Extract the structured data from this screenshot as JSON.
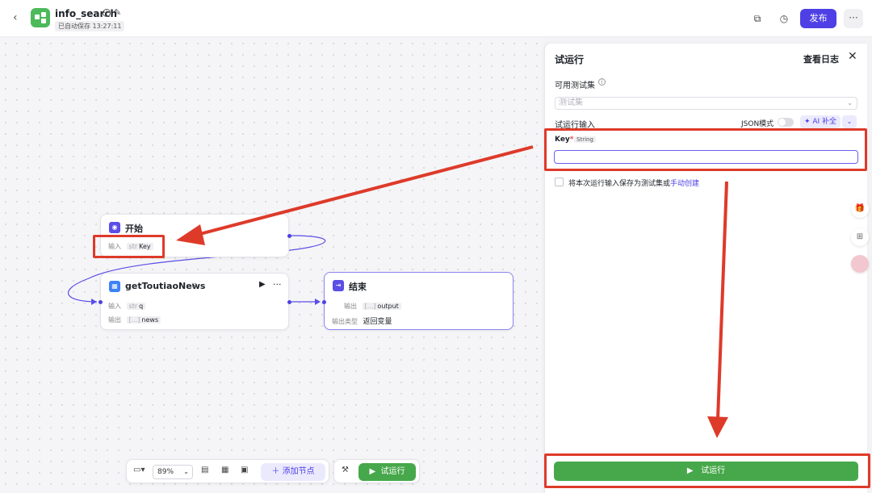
{
  "header": {
    "app_name": "info_search",
    "autosave": "已自动保存 13:27:11",
    "publish_label": "发布",
    "more_label": "···"
  },
  "nodes": {
    "start": {
      "title": "开始",
      "input_label": "输入",
      "input_type": "str",
      "input_name": "Key"
    },
    "plugin": {
      "title": "getToutiaoNews",
      "more_label": "···",
      "input_label": "输入",
      "input_type": "str",
      "input_name": "q",
      "output_label": "输出",
      "output_type": "[...]",
      "output_name": "news"
    },
    "end": {
      "title": "结束",
      "output_label": "输出",
      "output_type": "[...]",
      "output_name": "output",
      "output_kind_label": "输出类型",
      "output_kind_value": "返回变量"
    }
  },
  "toolbar": {
    "zoom": "89%",
    "add_node_label": "＋  添加节点",
    "run_label": "试运行"
  },
  "panel": {
    "title": "试运行",
    "view_log": "查看日志",
    "testset_label": "可用测试集",
    "testset_placeholder": "测试集",
    "input_label": "试运行输入",
    "json_mode": "JSON模式",
    "ai_fill": "AI 补全",
    "key_label": "Key",
    "key_type": "String",
    "key_value": "",
    "save_prefix": "将本次运行输入保存为测试集或",
    "save_link": "手动创建",
    "run_label": "试运行"
  },
  "colors": {
    "accent": "#4e40e5",
    "run_green": "#46a84a",
    "annotation_red": "#de3a2a",
    "app_icon": "#4cba5a"
  },
  "icons": [
    "back-chevron-icon",
    "workflow-app-icon",
    "info-icon",
    "edit-icon",
    "copy-icon",
    "history-icon",
    "start-node-icon",
    "plugin-node-icon",
    "end-node-icon",
    "play-icon",
    "layout-icon",
    "grid-icon",
    "comment-icon",
    "minimap-icon",
    "tools-icon",
    "close-icon",
    "gift-icon",
    "apps-icon",
    "avatar-icon"
  ]
}
